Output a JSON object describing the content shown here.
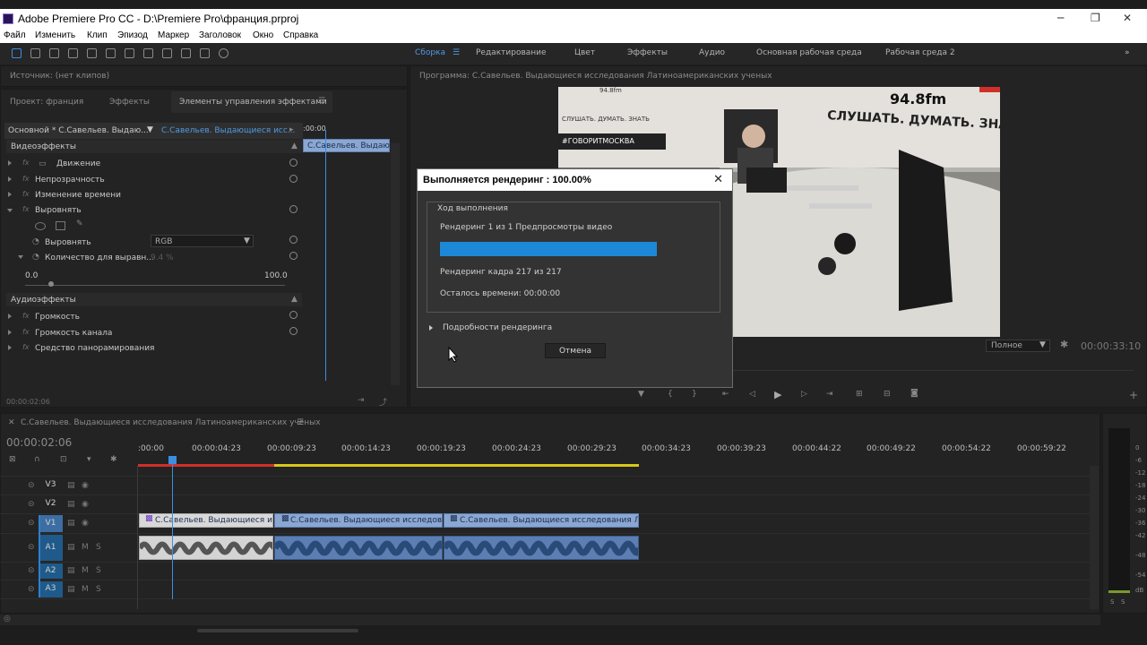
{
  "window": {
    "title": "Adobe Premiere Pro CC - D:\\Premiere Pro\\франция.prproj",
    "controls": [
      "─",
      "❐",
      "✕"
    ]
  },
  "menu": [
    "Файл",
    "Изменить",
    "Клип",
    "Эпизод",
    "Маркер",
    "Заголовок",
    "Окно",
    "Справка"
  ],
  "workspaces": [
    "Сборка",
    "Редактирование",
    "Цвет",
    "Эффекты",
    "Аудио",
    "Основная рабочая среда",
    "Рабочая среда 2"
  ],
  "source_panel": {
    "title": "Источник: (нет клипов)"
  },
  "left_tabs": [
    "Проект: франция",
    "Эффекты",
    "Элементы управления эффектами"
  ],
  "effect_controls": {
    "master": "Основной * С.Савельев. Выдаю...",
    "clip": "С.Савельев. Выдающиеся исс...",
    "timecode_start": ":00:00",
    "clip_bar": "С.Савельев. Выдающ",
    "video_section": "Видеоэффекты",
    "video_items": [
      "Движение",
      "Непрозрачность",
      "Изменение времени",
      "Выровнять"
    ],
    "align_label": "Выровнять",
    "align_value": "RGB",
    "amount_label": "Количество для выравн...",
    "amount_value": "9.4 %",
    "slider_min": "0.0",
    "slider_max": "100.0",
    "audio_section": "Аудиоэффекты",
    "audio_items": [
      "Громкость",
      "Громкость канала",
      "Средство панорамирования"
    ],
    "footer_time": "00:00:02:06"
  },
  "program": {
    "title": "Программа: С.Савельев. Выдающиеся исследования Латиноамериканских ученых",
    "quality": "Полное",
    "timecode": "00:00:33:10",
    "video_text": {
      "freq": "94.8fm",
      "slogan": "СЛУШАТЬ. ДУМАТЬ. ЗНАТЬ",
      "small": "СЛУШАТЬ. ДУМАТЬ. ЗНАТЬ",
      "hashtag": "#ГОВОРИТМОСКВА",
      "top": "94.8fm"
    }
  },
  "render_dialog": {
    "title": "Выполняется рендеринг : 100.00%",
    "group": "Ход выполнения",
    "line1": "Рендеринг 1 из 1 Предпросмотры видео",
    "progress": 1.0,
    "line2": "Рендеринг кадра 217 из 217",
    "line3": "Осталось времени: 00:00:00",
    "details": "Подробности рендеринга",
    "cancel": "Отмена"
  },
  "timeline": {
    "title": "С.Савельев. Выдающиеся исследования Латиноамериканских ученых",
    "timecode": "00:00:02:06",
    "ruler": [
      ":00:00",
      "00:00:04:23",
      "00:00:09:23",
      "00:00:14:23",
      "00:00:19:23",
      "00:00:24:23",
      "00:00:29:23",
      "00:00:34:23",
      "00:00:39:23",
      "00:00:44:22",
      "00:00:49:22",
      "00:00:54:22",
      "00:00:59:22"
    ],
    "tracks": [
      "V3",
      "V2",
      "V1",
      "A1",
      "A2",
      "A3"
    ],
    "track_buttons": {
      "m": "M",
      "s": "S"
    },
    "clips": [
      "С.Савельев. Выдающиеся исс",
      "С.Савельев. Выдающиеся исследовани",
      "С.Савельев. Выдающиеся исследования Лати"
    ],
    "meter_labels": [
      "0",
      "-6",
      "-12",
      "-18",
      "-24",
      "-30",
      "-36",
      "-42",
      "-48",
      "-54",
      "dB"
    ],
    "meter_solo": [
      "S",
      "S"
    ]
  },
  "colors": {
    "accent": "#1d88d8",
    "clip_video": "#8aa7d2",
    "clip_audio": "#5c7eb2",
    "render_red": "#d0302a",
    "render_yellow": "#d8c81a"
  }
}
